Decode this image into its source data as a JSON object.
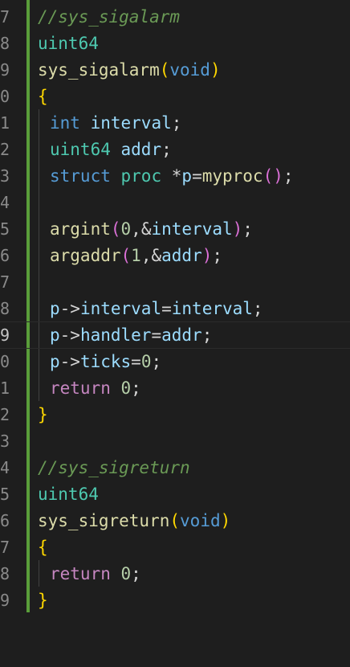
{
  "gutter": {
    "line_numbers": [
      "7",
      "8",
      "9",
      "0",
      "1",
      "2",
      "3",
      "4",
      "5",
      "6",
      "7",
      "8",
      "9",
      "0",
      "1",
      "2",
      "3",
      "4",
      "5",
      "6",
      "7",
      "8",
      "9"
    ],
    "active_index": 12
  },
  "code": {
    "l1": {
      "comment": "//sys_sigalarm"
    },
    "l2": {
      "type": "uint64"
    },
    "l3": {
      "fn": "sys_sigalarm",
      "open": "(",
      "kw": "void",
      "close": ")"
    },
    "l4": {
      "brace": "{"
    },
    "l5": {
      "kw": "int",
      "var": "interval",
      "end": ";"
    },
    "l6": {
      "type": "uint64",
      "var": "addr",
      "end": ";"
    },
    "l7": {
      "kw": "struct",
      "type": "proc",
      "star": "*",
      "var": "p",
      "eq": "=",
      "fn": "myproc",
      "paren": "()",
      "end": ";"
    },
    "l9": {
      "fn": "argint",
      "open": "(",
      "num": "0",
      "comma": ",",
      "amp": "&",
      "var": "interval",
      "close": ")",
      "end": ";"
    },
    "l10": {
      "fn": "argaddr",
      "open": "(",
      "num": "1",
      "comma": ",",
      "amp": "&",
      "var": "addr",
      "close": ")",
      "end": ";"
    },
    "l12": {
      "var1": "p",
      "arrow": "->",
      "field": "interval",
      "eq": "=",
      "var2": "interval",
      "end": ";"
    },
    "l13": {
      "var1": "p",
      "arrow": "->",
      "field": "handler",
      "eq": "=",
      "var2": "addr",
      "end": ";"
    },
    "l14": {
      "var1": "p",
      "arrow": "->",
      "field": "ticks",
      "eq": "=",
      "num": "0",
      "end": ";"
    },
    "l15": {
      "kw": "return",
      "num": "0",
      "end": ";"
    },
    "l16": {
      "brace": "}"
    },
    "l18": {
      "comment": "//sys_sigreturn"
    },
    "l19": {
      "type": "uint64"
    },
    "l20": {
      "fn": "sys_sigreturn",
      "open": "(",
      "kw": "void",
      "close": ")"
    },
    "l21": {
      "brace": "{"
    },
    "l22": {
      "kw": "return",
      "num": "0",
      "end": ";"
    },
    "l23": {
      "brace": "}"
    }
  }
}
